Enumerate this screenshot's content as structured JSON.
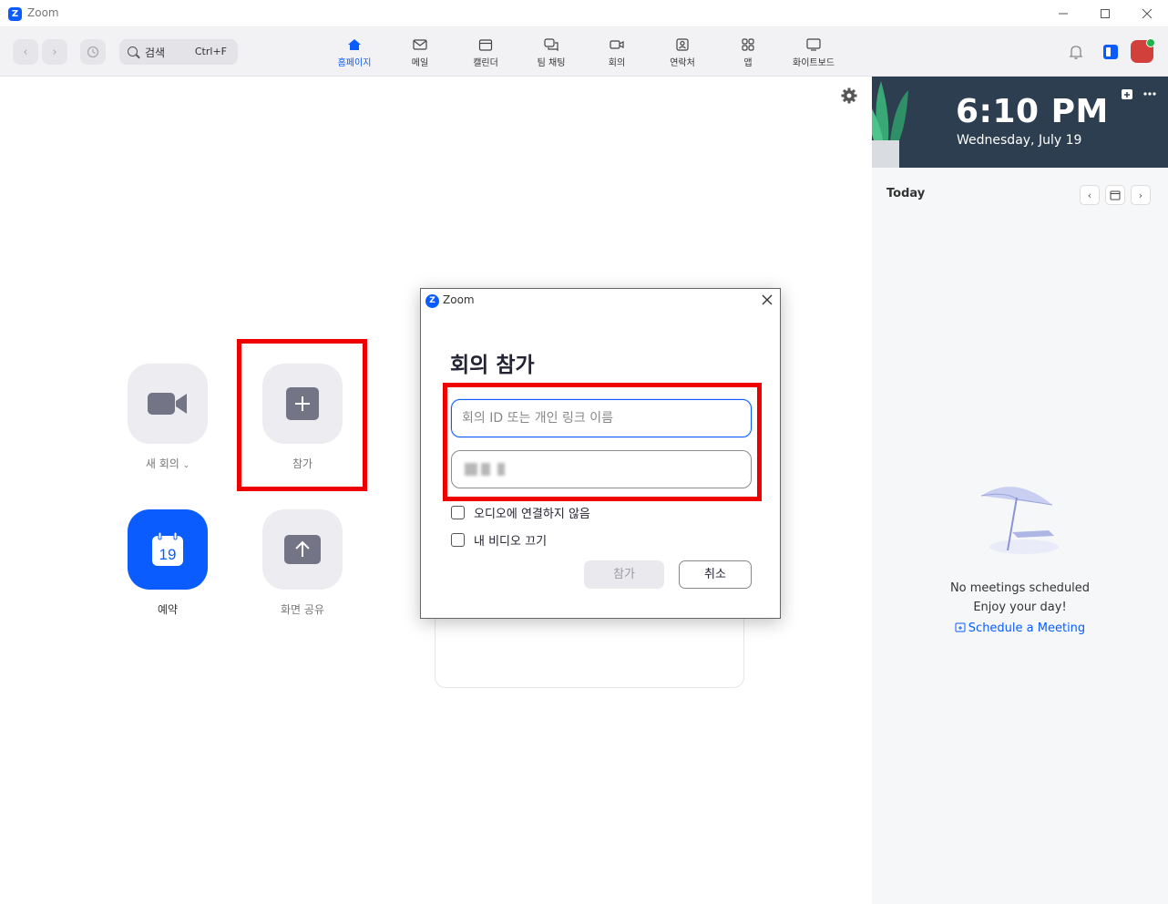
{
  "window": {
    "app_name": "Zoom",
    "logo_letter": "Z"
  },
  "toolbar": {
    "search_placeholder": "검색",
    "search_shortcut": "Ctrl+F",
    "tabs": [
      {
        "label": "홈페이지",
        "icon": "home-icon",
        "active": true
      },
      {
        "label": "메일",
        "icon": "mail-icon",
        "active": false
      },
      {
        "label": "캘린더",
        "icon": "calendar-icon",
        "active": false
      },
      {
        "label": "팀 채팅",
        "icon": "chat-icon",
        "active": false
      },
      {
        "label": "회의",
        "icon": "video-icon",
        "active": false
      },
      {
        "label": "연락처",
        "icon": "contacts-icon",
        "active": false
      },
      {
        "label": "앱",
        "icon": "apps-icon",
        "active": false
      },
      {
        "label": "화이트보드",
        "icon": "whiteboard-icon",
        "active": false
      }
    ]
  },
  "home": {
    "new_meeting_label": "새 회의",
    "join_label": "참가",
    "schedule_label": "예약",
    "schedule_day": "19",
    "share_screen_label": "화면 공유"
  },
  "right_panel": {
    "time": "6:10 PM",
    "date": "Wednesday, July 19",
    "today_label": "Today",
    "empty_line1": "No meetings scheduled",
    "empty_line2": "Enjoy your day!",
    "schedule_link": "Schedule a Meeting"
  },
  "dialog": {
    "window_title": "Zoom",
    "heading": "회의 참가",
    "meeting_id_placeholder": "회의 ID 또는 개인 링크 이름",
    "no_audio_label": "오디오에 연결하지 않음",
    "video_off_label": "내 비디오 끄기",
    "join_button": "참가",
    "cancel_button": "취소"
  },
  "colors": {
    "accent": "#0b5cff",
    "highlight": "#ee0000",
    "banner": "#2c3e50"
  }
}
